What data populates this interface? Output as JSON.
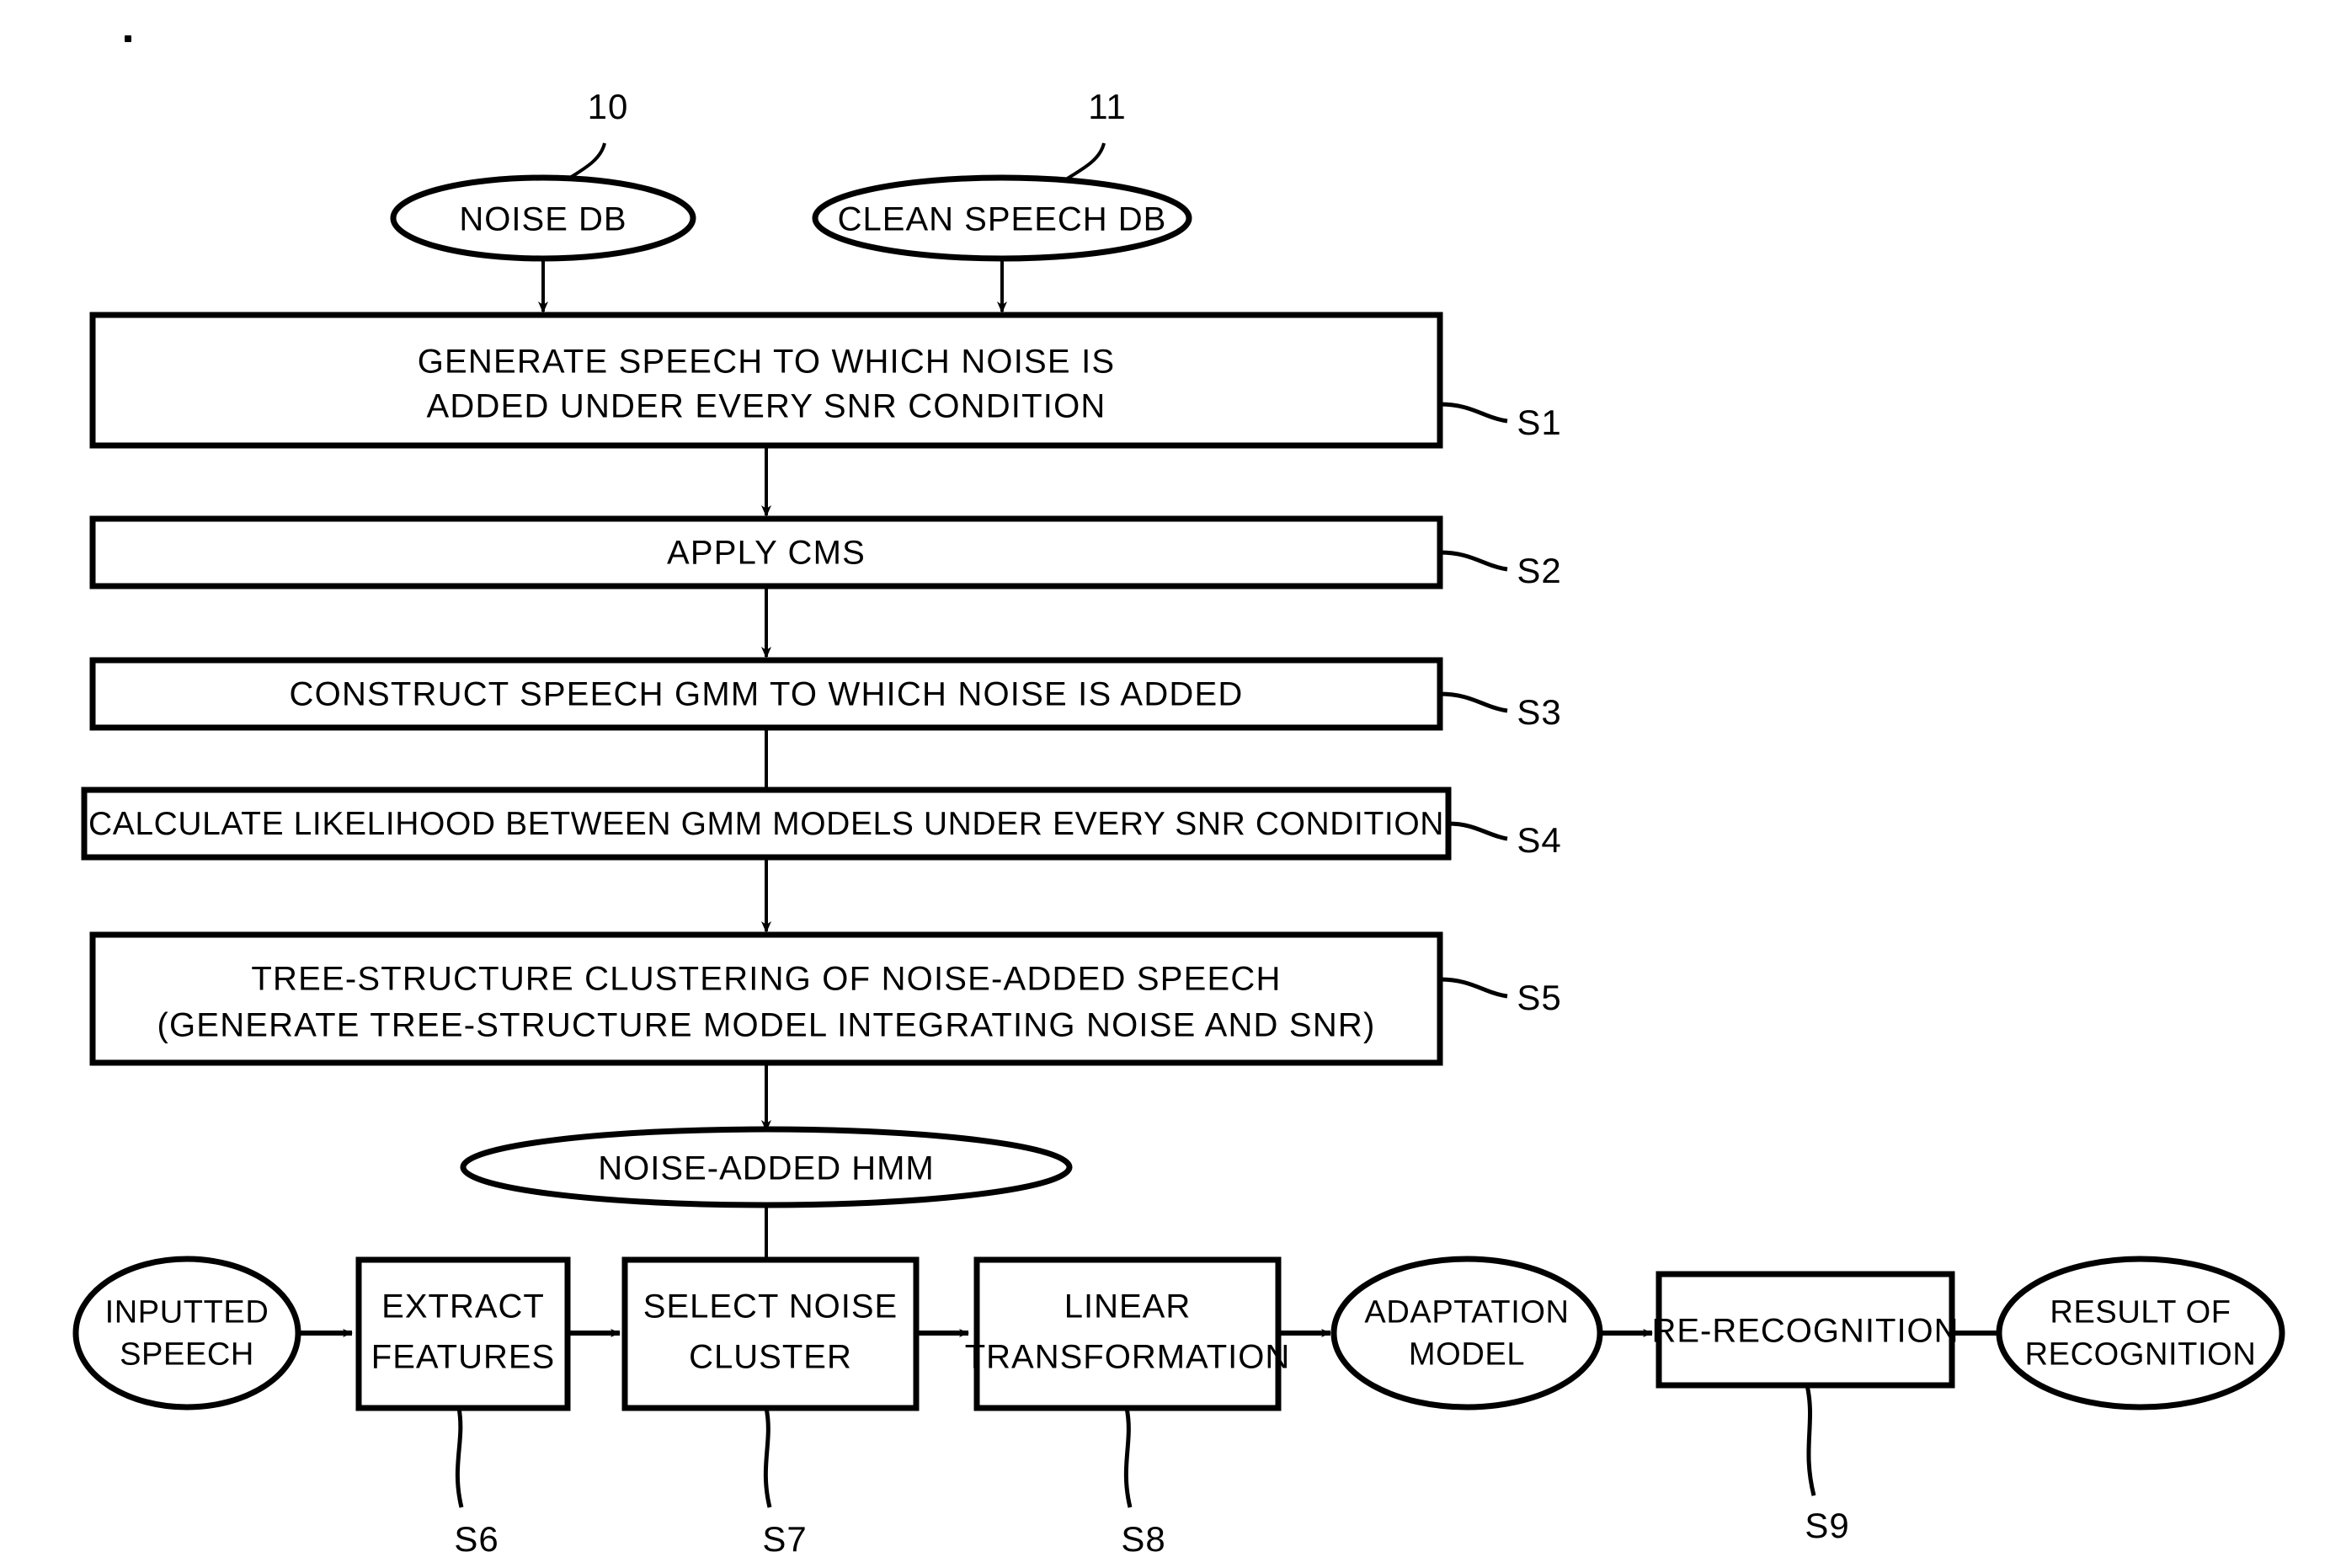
{
  "figure": {
    "type": "flowchart",
    "background_color": "#ffffff",
    "line_color": "#000000",
    "reference_numerals": [
      {
        "id": "ref-10",
        "text": "10",
        "points_to": "NOISE DB"
      },
      {
        "id": "ref-11",
        "text": "11",
        "points_to": "CLEAN SPEECH DB"
      }
    ],
    "sources": [
      {
        "id": "noise-db",
        "shape": "ellipse",
        "label": "NOISE DB"
      },
      {
        "id": "clean-speech-db",
        "shape": "ellipse",
        "label": "CLEAN SPEECH DB"
      }
    ],
    "steps": [
      {
        "id": "s1",
        "step_label": "S1",
        "shape": "rect",
        "lines": [
          "GENERATE SPEECH TO WHICH NOISE IS",
          "ADDED UNDER EVERY SNR CONDITION"
        ]
      },
      {
        "id": "s2",
        "step_label": "S2",
        "shape": "rect",
        "lines": [
          "APPLY CMS"
        ]
      },
      {
        "id": "s3",
        "step_label": "S3",
        "shape": "rect",
        "lines": [
          "CONSTRUCT SPEECH GMM TO WHICH NOISE IS ADDED"
        ]
      },
      {
        "id": "s4",
        "step_label": "S4",
        "shape": "rect",
        "lines": [
          "CALCULATE LIKELIHOOD BETWEEN GMM MODELS UNDER EVERY SNR CONDITION"
        ]
      },
      {
        "id": "s5",
        "step_label": "S5",
        "shape": "rect",
        "lines": [
          "TREE-STRUCTURE CLUSTERING OF NOISE-ADDED SPEECH",
          "(GENERATE TREE-STRUCTURE MODEL INTEGRATING NOISE AND SNR)"
        ]
      }
    ],
    "intermediate": {
      "id": "noise-added-hmm",
      "shape": "ellipse",
      "label": "NOISE-ADDED HMM"
    },
    "pipeline": [
      {
        "id": "inputted-speech",
        "shape": "ellipse",
        "lines": [
          "INPUTTED",
          "SPEECH"
        ],
        "step_label": ""
      },
      {
        "id": "extract-features",
        "shape": "rect",
        "lines": [
          "EXTRACT",
          "FEATURES"
        ],
        "step_label": "S6"
      },
      {
        "id": "select-noise-cluster",
        "shape": "rect",
        "lines": [
          "SELECT NOISE",
          "CLUSTER"
        ],
        "step_label": "S7"
      },
      {
        "id": "linear-transformation",
        "shape": "rect",
        "lines": [
          "LINEAR",
          "TRANSFORMATION"
        ],
        "step_label": "S8"
      },
      {
        "id": "adaptation-model",
        "shape": "ellipse",
        "lines": [
          "ADAPTATION",
          "MODEL"
        ],
        "step_label": ""
      },
      {
        "id": "re-recognition",
        "shape": "rect",
        "lines": [
          "RE-RECOGNITION"
        ],
        "step_label": "S9"
      },
      {
        "id": "result-of-recognition",
        "shape": "ellipse",
        "lines": [
          "RESULT OF",
          "RECOGNITION"
        ],
        "step_label": ""
      }
    ]
  }
}
